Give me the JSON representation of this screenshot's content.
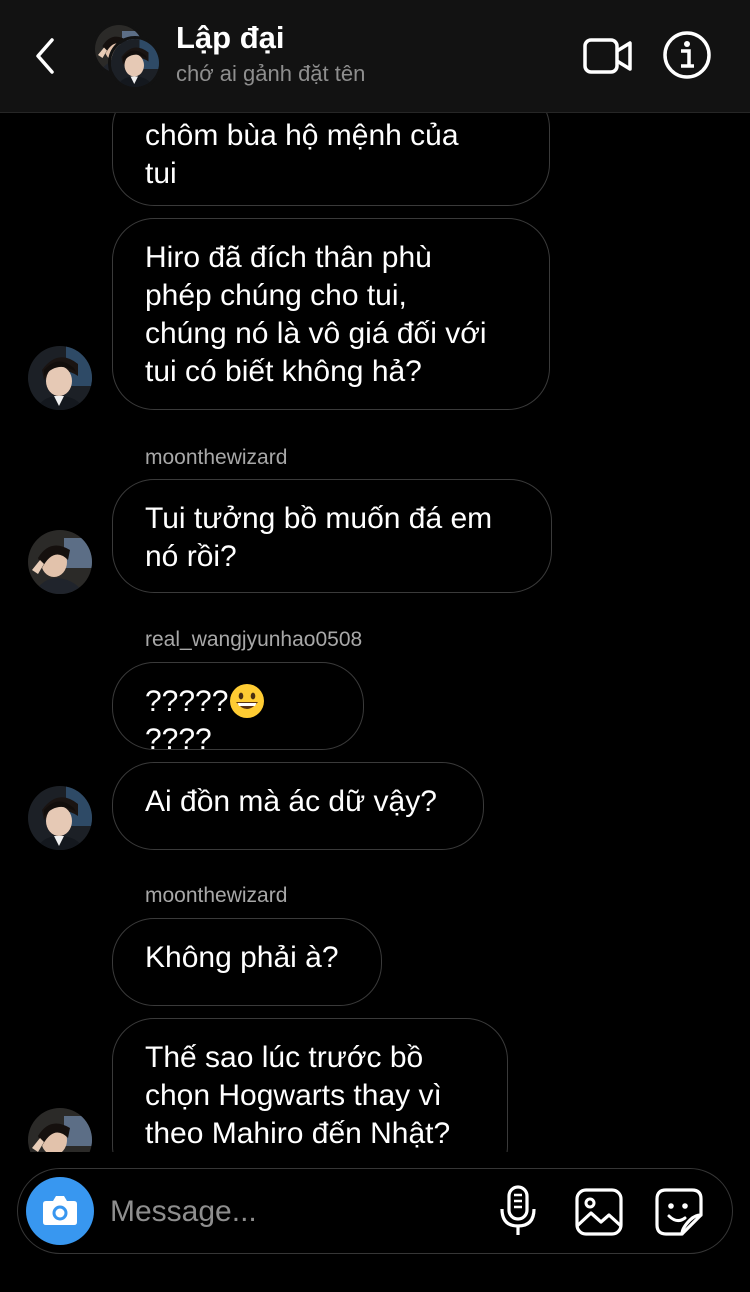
{
  "header": {
    "title": "Lập đại",
    "subtitle": "chớ ai gảnh đặt tên"
  },
  "messages": [
    {
      "text": "chôm bùa hộ mệnh của\ntui"
    },
    {
      "text": "Hiro đã đích thân phù\nphép chúng cho tui,\nchúng nó là vô giá đối với\ntui có biết không hả?"
    },
    {
      "sender": "moonthewizard",
      "text": "Tui tưởng bồ muốn đá em\nnó rồi?"
    },
    {
      "sender": "real_wangjyunhao0508",
      "text_before": "?????",
      "text_after": "????"
    },
    {
      "text": "Ai đồn mà ác dữ vậy?"
    },
    {
      "sender": "moonthewizard",
      "text": "Không phải à?"
    },
    {
      "text": "Thế sao lúc trước bồ\nchọn Hogwarts thay vì\ntheo Mahiro đến Nhật?"
    }
  ],
  "composer": {
    "placeholder": "Message..."
  },
  "icons": {
    "back": "chevron-left-icon",
    "video": "video-camera-icon",
    "info": "info-icon",
    "camera": "camera-icon",
    "mic": "microphone-icon",
    "gallery": "image-icon",
    "sticker": "sticker-icon",
    "emoji": "grinning-face-emoji"
  },
  "colors": {
    "background": "#000000",
    "header": "#121212",
    "bubble_border": "#3a3a3a",
    "camera_button": "#3897f0",
    "secondary_text": "#8e8e8e"
  }
}
